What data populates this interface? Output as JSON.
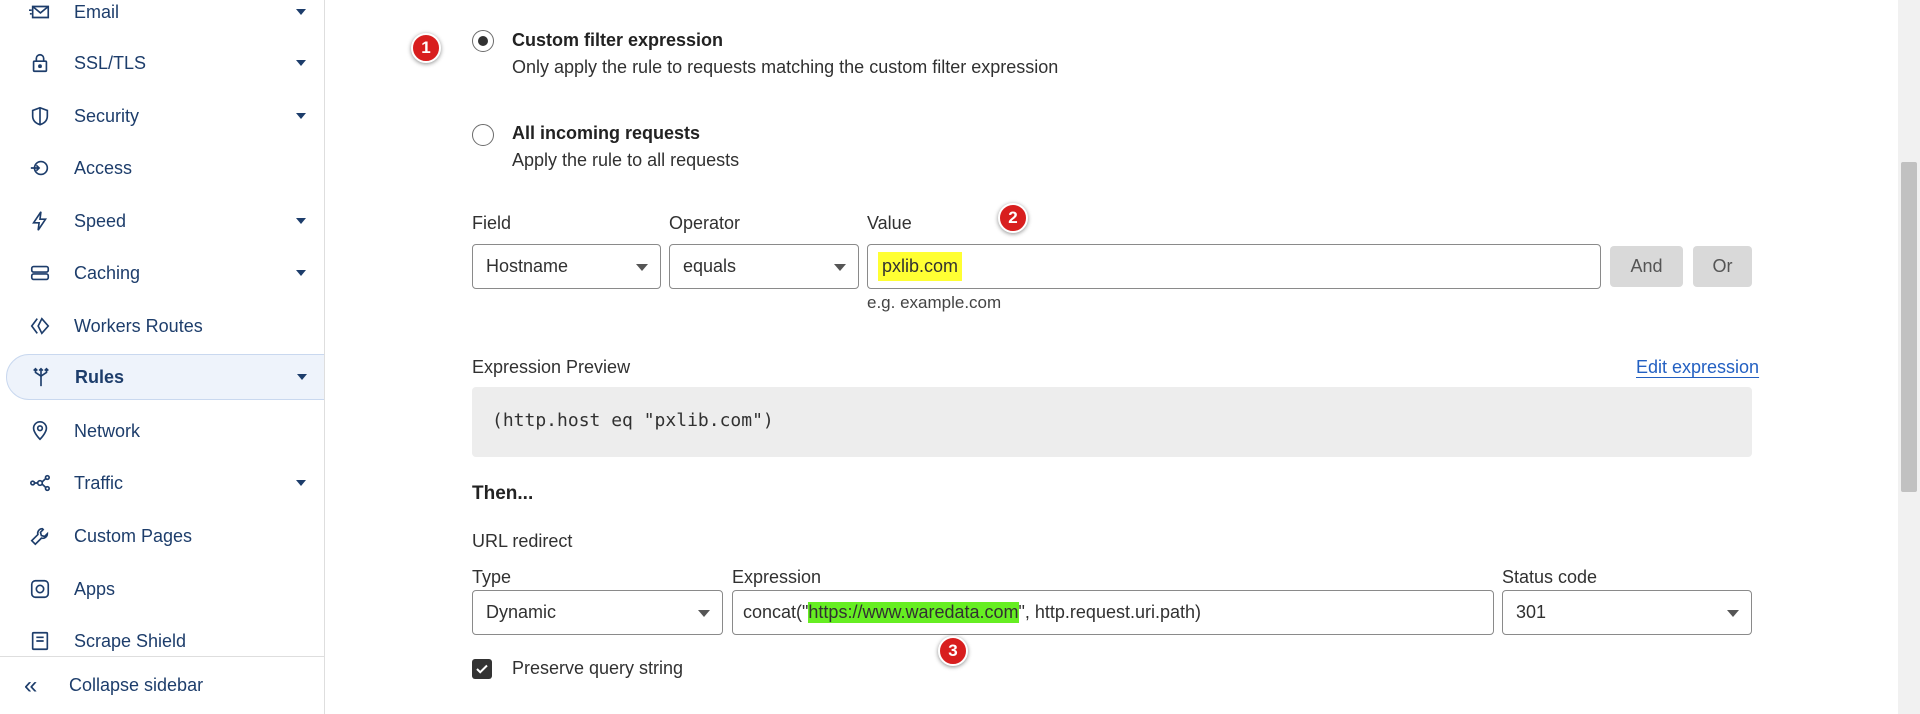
{
  "sidebar": {
    "items": [
      {
        "label": "Email",
        "icon": "email-icon",
        "has_caret": true
      },
      {
        "label": "SSL/TLS",
        "icon": "lock-icon",
        "has_caret": true
      },
      {
        "label": "Security",
        "icon": "shield-icon",
        "has_caret": true
      },
      {
        "label": "Access",
        "icon": "access-icon",
        "has_caret": false
      },
      {
        "label": "Speed",
        "icon": "lightning-icon",
        "has_caret": true
      },
      {
        "label": "Caching",
        "icon": "database-icon",
        "has_caret": true
      },
      {
        "label": "Workers Routes",
        "icon": "workers-icon",
        "has_caret": false
      },
      {
        "label": "Rules",
        "icon": "rules-icon",
        "has_caret": true,
        "active": true
      },
      {
        "label": "Network",
        "icon": "location-pin-icon",
        "has_caret": false
      },
      {
        "label": "Traffic",
        "icon": "traffic-icon",
        "has_caret": true
      },
      {
        "label": "Custom Pages",
        "icon": "wrench-icon",
        "has_caret": false
      },
      {
        "label": "Apps",
        "icon": "apps-icon",
        "has_caret": false
      },
      {
        "label": "Scrape Shield",
        "icon": "document-icon",
        "has_caret": false
      }
    ],
    "collapse_label": "Collapse sidebar"
  },
  "filter_options": {
    "custom": {
      "title": "Custom filter expression",
      "desc": "Only apply the rule to requests matching the custom filter expression",
      "selected": true
    },
    "all": {
      "title": "All incoming requests",
      "desc": "Apply the rule to all requests",
      "selected": false
    }
  },
  "badges": {
    "one": "1",
    "two": "2",
    "three": "3"
  },
  "condition": {
    "field_label": "Field",
    "operator_label": "Operator",
    "value_label": "Value",
    "field_value": "Hostname",
    "operator_value": "equals",
    "value_value": "pxlib.com",
    "value_hint": "e.g. example.com",
    "and_label": "And",
    "or_label": "Or"
  },
  "preview": {
    "label": "Expression Preview",
    "edit_link": "Edit expression",
    "expression": "(http.host eq \"pxlib.com\")"
  },
  "then": {
    "heading": "Then...",
    "action": "URL redirect",
    "type_label": "Type",
    "type_value": "Dynamic",
    "expression_label": "Expression",
    "expr_prefix": "concat(\"",
    "expr_url": "https://www.waredata.com",
    "expr_suffix": "\", http.request.uri.path)",
    "status_label": "Status code",
    "status_value": "301",
    "preserve_label": "Preserve query string",
    "preserve_checked": true
  },
  "colors": {
    "nav_text": "#1d3d6b",
    "badge_red": "#d81e1e",
    "highlight_yellow": "#ffff33",
    "highlight_green": "#66ee22",
    "link_blue": "#2360c2"
  }
}
